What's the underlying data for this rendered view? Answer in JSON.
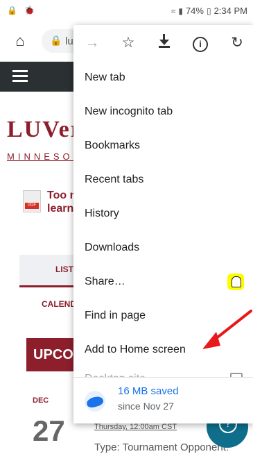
{
  "status_bar": {
    "left_icons": [
      "lock-status-icon",
      "bug-notification-icon"
    ],
    "battery": "74%",
    "time": "2:34 PM",
    "signal_icons": [
      "wifi-icon",
      "lte-icon",
      "signal-bars-icon"
    ]
  },
  "address_bar": {
    "url_partial": "lu"
  },
  "background_page": {
    "logo_text": "LUVer",
    "logo_subtitle": "MINNESOT",
    "doc_link_line1": "Too n",
    "doc_link_line2": "learn",
    "pdf_tag": "PDF",
    "tab_list": "LIST",
    "tab_calendar": "CALEND",
    "upcoming": "UPCO",
    "month": "DEC",
    "day": "27",
    "event_time": "Thursday, 12:00am CST",
    "event_type": "Type: Tournament Opponent:",
    "help_glyph": "?"
  },
  "menu": {
    "icons": [
      "forward-icon",
      "star-icon",
      "download-icon",
      "info-icon",
      "reload-icon"
    ],
    "items": [
      {
        "label": "New tab"
      },
      {
        "label": "New incognito tab"
      },
      {
        "label": "Bookmarks"
      },
      {
        "label": "Recent tabs"
      },
      {
        "label": "History"
      },
      {
        "label": "Downloads"
      },
      {
        "label": "Share…"
      },
      {
        "label": "Find in page"
      },
      {
        "label": "Add to Home screen"
      },
      {
        "label": "Desktop site"
      }
    ],
    "savings": {
      "amount": "16 MB saved",
      "since": "since Nov 27"
    }
  },
  "annotation": {
    "arrow_color": "#e8191b"
  },
  "colors": {
    "brand": "#8d1f2c",
    "nav_bg": "#2b3033",
    "savings_blue": "#1a73e8"
  }
}
